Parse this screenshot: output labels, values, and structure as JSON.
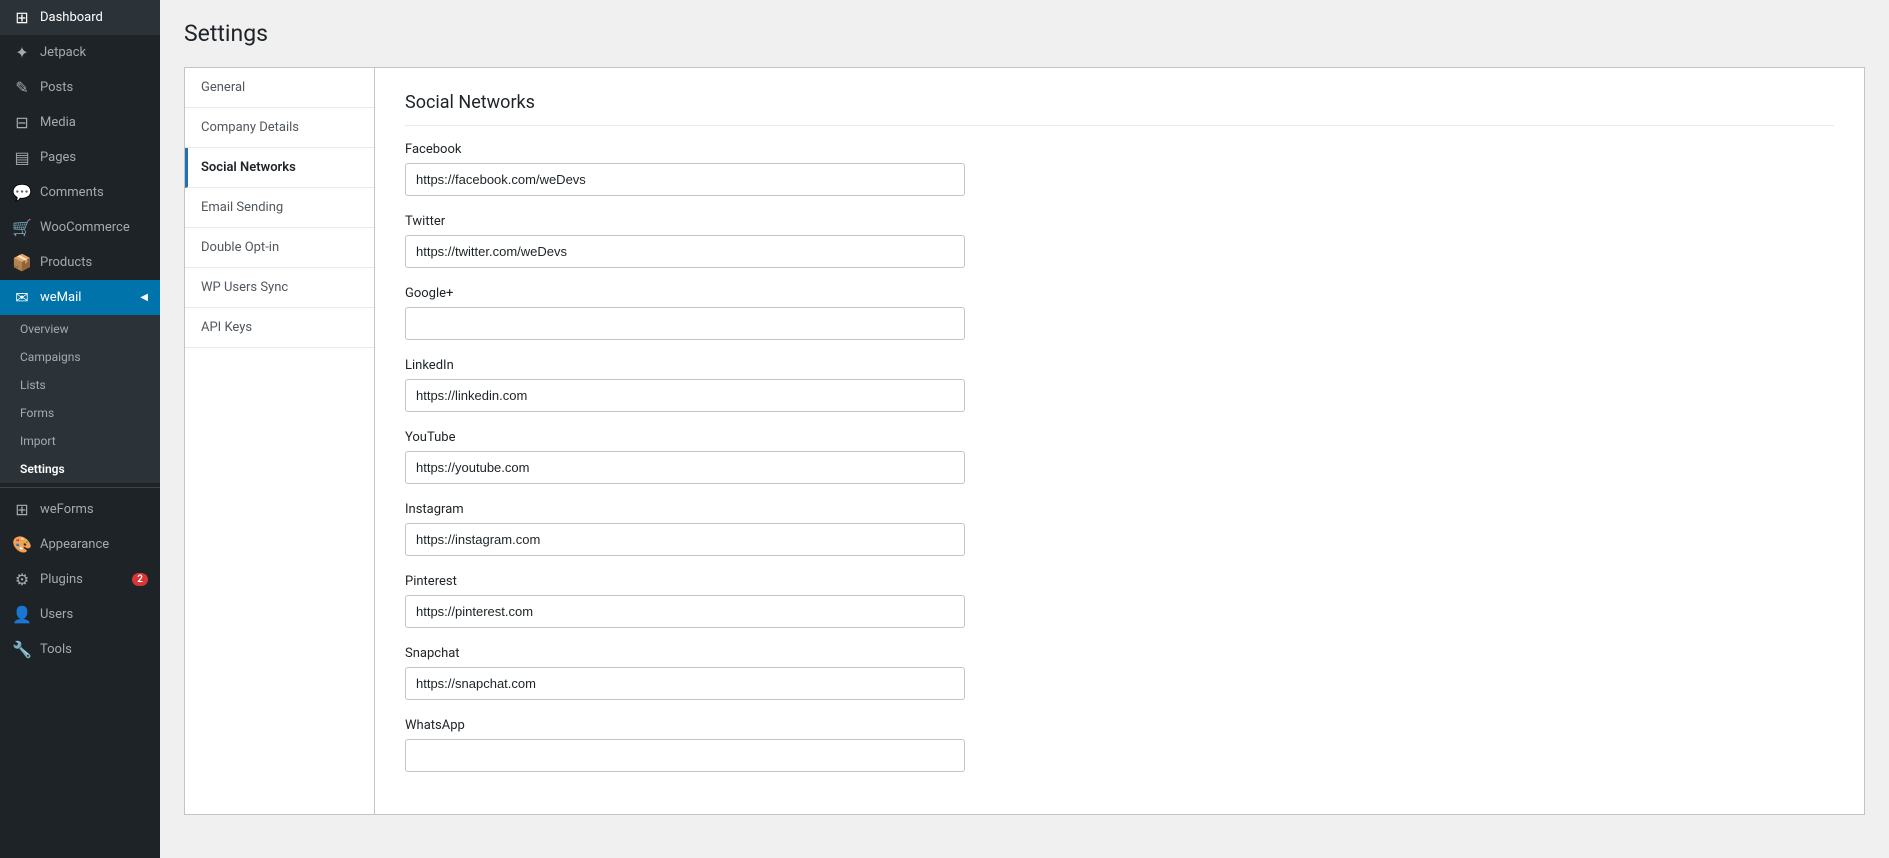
{
  "page": {
    "title": "Settings"
  },
  "sidebar": {
    "items": [
      {
        "id": "dashboard",
        "label": "Dashboard",
        "icon": "⊞"
      },
      {
        "id": "jetpack",
        "label": "Jetpack",
        "icon": "✦"
      },
      {
        "id": "posts",
        "label": "Posts",
        "icon": "✎"
      },
      {
        "id": "media",
        "label": "Media",
        "icon": "⊟"
      },
      {
        "id": "pages",
        "label": "Pages",
        "icon": "▤"
      },
      {
        "id": "comments",
        "label": "Comments",
        "icon": "💬"
      },
      {
        "id": "woocommerce",
        "label": "WooCommerce",
        "icon": "🛒"
      },
      {
        "id": "products",
        "label": "Products",
        "icon": "📦"
      },
      {
        "id": "wemail",
        "label": "weMail",
        "icon": "✉"
      }
    ],
    "wemail_submenu": [
      {
        "id": "overview",
        "label": "Overview"
      },
      {
        "id": "campaigns",
        "label": "Campaigns"
      },
      {
        "id": "lists",
        "label": "Lists"
      },
      {
        "id": "forms",
        "label": "Forms"
      },
      {
        "id": "import",
        "label": "Import"
      },
      {
        "id": "settings",
        "label": "Settings",
        "active": true
      }
    ],
    "bottom_items": [
      {
        "id": "weforms",
        "label": "weForms",
        "icon": "⊞"
      },
      {
        "id": "appearance",
        "label": "Appearance",
        "icon": "🎨"
      },
      {
        "id": "plugins",
        "label": "Plugins",
        "icon": "⚙",
        "badge": "2"
      },
      {
        "id": "users",
        "label": "Users",
        "icon": "👤"
      },
      {
        "id": "tools",
        "label": "Tools",
        "icon": "🔧"
      }
    ]
  },
  "settings_nav": [
    {
      "id": "general",
      "label": "General"
    },
    {
      "id": "company-details",
      "label": "Company Details"
    },
    {
      "id": "social-networks",
      "label": "Social Networks",
      "active": true
    },
    {
      "id": "email-sending",
      "label": "Email Sending"
    },
    {
      "id": "double-opt-in",
      "label": "Double Opt-in"
    },
    {
      "id": "wp-users-sync",
      "label": "WP Users Sync"
    },
    {
      "id": "api-keys",
      "label": "API Keys"
    }
  ],
  "social_networks": {
    "section_title": "Social Networks",
    "fields": [
      {
        "id": "facebook",
        "label": "Facebook",
        "value": "https://facebook.com/weDevs",
        "placeholder": ""
      },
      {
        "id": "twitter",
        "label": "Twitter",
        "value": "https://twitter.com/weDevs",
        "placeholder": ""
      },
      {
        "id": "google-plus",
        "label": "Google+",
        "value": "",
        "placeholder": ""
      },
      {
        "id": "linkedin",
        "label": "LinkedIn",
        "value": "https://linkedin.com",
        "placeholder": ""
      },
      {
        "id": "youtube",
        "label": "YouTube",
        "value": "https://youtube.com",
        "placeholder": ""
      },
      {
        "id": "instagram",
        "label": "Instagram",
        "value": "https://instagram.com",
        "placeholder": ""
      },
      {
        "id": "pinterest",
        "label": "Pinterest",
        "value": "https://pinterest.com",
        "placeholder": ""
      },
      {
        "id": "snapchat",
        "label": "Snapchat",
        "value": "https://snapchat.com",
        "placeholder": ""
      },
      {
        "id": "whatsapp",
        "label": "WhatsApp",
        "value": "",
        "placeholder": ""
      }
    ]
  }
}
